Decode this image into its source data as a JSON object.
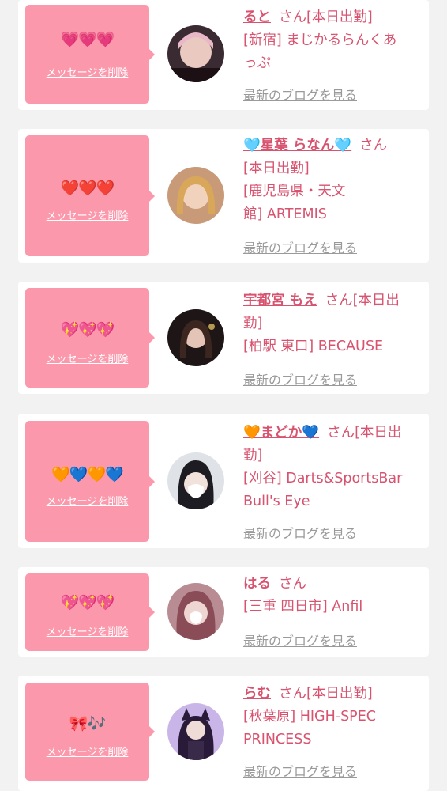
{
  "delete_label": "メッセージを削除",
  "blog_label": "最新のブログを見る",
  "cards": [
    {
      "emoji": "💗💗💗",
      "name": "ると",
      "suffix": "さん[本日出勤]",
      "shop_line1": "[新宿] まじかるらんくあ",
      "shop_line2": "っぷ"
    },
    {
      "emoji": "❤️❤️❤️",
      "name": "🩵星葉 らなん🩵",
      "suffix": "さん",
      "line_a": "[本日出勤]",
      "shop_line1": "[鹿児島県・天文",
      "shop_line2": "館] ARTEMIS"
    },
    {
      "emoji": "💖💖💖",
      "name": "宇都宮 もえ",
      "suffix": "さん[本日出",
      "line_a": "勤]",
      "shop_line1": "[柏駅 東口] BECAUSE"
    },
    {
      "emoji": "🧡💙🧡💙",
      "name": "🧡まどか💙",
      "suffix": "さん[本日出",
      "line_a": "勤]",
      "shop_line1": "[刈谷] Darts&SportsBar",
      "shop_line2": "Bull's Eye"
    },
    {
      "emoji": "💖💖💖",
      "name": "はる",
      "suffix": "さん",
      "shop_line1": "[三重 四日市] Anfil"
    },
    {
      "emoji": "🎀🎶",
      "name": "らむ",
      "suffix": "さん[本日出勤]",
      "shop_line1": "[秋葉原] HIGH-SPEC",
      "shop_line2": "PRINCESS"
    }
  ]
}
